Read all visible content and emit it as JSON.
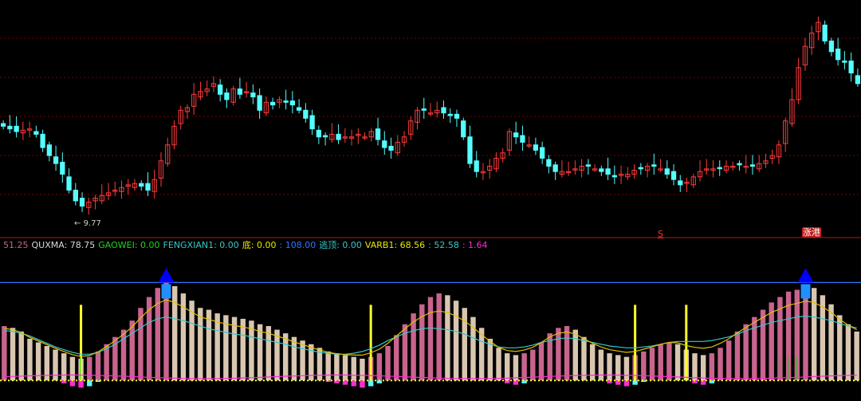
{
  "colors": {
    "background": "#000000",
    "up_candle": "#ff3b3b",
    "down_candle": "#54ffff",
    "grid": "#7a0000",
    "divider": "#b01818",
    "ceiling_line": "#2e74ff",
    "pink_bars": "#c9648e",
    "tan_bars": "#d9c6b0",
    "yellow": "#ffff2a",
    "magenta": "#ff2bd4",
    "cyan_line": "#38c8c8",
    "gold_line": "#e0c000",
    "green_ticks": "#11c811"
  },
  "price_panel": {
    "low_label": "9.77",
    "signal_s": "S",
    "signal_zg": "涨港"
  },
  "indicator_legend": [
    {
      "text": "51.25",
      "color": "#c9648e"
    },
    {
      "text": "QUXMA: 78.75",
      "color": "#d8d8d8"
    },
    {
      "text": "GAOWEI: 0.00",
      "color": "#22d022"
    },
    {
      "text": "FENGXIAN1: 0.00",
      "color": "#38c8c8"
    },
    {
      "text": "底: 0.00",
      "color": "#e8e800"
    },
    {
      "text": ": 108.00",
      "color": "#2e74ff"
    },
    {
      "text": "逃顶: 0.00",
      "color": "#38c8c8"
    },
    {
      "text": "VARB1: 68.56",
      "color": "#e8e800"
    },
    {
      "text": ": 52.58",
      "color": "#38c8c8"
    },
    {
      "text": ": 1.64",
      "color": "#ff2bd4"
    }
  ],
  "chart_data": [
    {
      "type": "candlestick",
      "title": "",
      "ylim": [
        9.0,
        17.5
      ],
      "min_label": 9.77,
      "candles_close": [
        13.0,
        12.9,
        12.8,
        12.85,
        12.9,
        12.7,
        12.2,
        11.9,
        11.6,
        11.2,
        10.6,
        10.2,
        10.0,
        10.15,
        10.3,
        10.4,
        10.5,
        10.6,
        10.7,
        10.8,
        10.85,
        10.75,
        10.6,
        11.0,
        11.7,
        12.3,
        13.0,
        13.6,
        13.7,
        14.2,
        14.3,
        14.4,
        14.6,
        14.2,
        14.0,
        14.4,
        14.2,
        14.3,
        14.1,
        13.6,
        13.9,
        13.8,
        14.0,
        13.9,
        13.8,
        13.6,
        13.3,
        12.9,
        12.6,
        12.6,
        12.7,
        12.5,
        12.6,
        12.6,
        12.7,
        12.6,
        12.8,
        12.5,
        12.2,
        12.1,
        12.4,
        12.6,
        13.2,
        13.6,
        13.6,
        13.5,
        13.6,
        13.5,
        13.4,
        13.3,
        12.6,
        11.6,
        11.3,
        11.3,
        11.5,
        11.8,
        12.0,
        12.8,
        12.6,
        12.4,
        12.3,
        12.1,
        11.8,
        11.5,
        11.3,
        11.3,
        11.3,
        11.4,
        11.5,
        11.5,
        11.4,
        11.3,
        11.2,
        11.1,
        11.2,
        11.2,
        11.35,
        11.4,
        11.5,
        11.5,
        11.4,
        11.2,
        11.0,
        10.8,
        10.9,
        11.1,
        11.3,
        11.4,
        11.4,
        11.45,
        11.5,
        11.5,
        11.55,
        11.5,
        11.5,
        11.6,
        11.7,
        11.9,
        12.3,
        13.2,
        14.0,
        15.2,
        16.0,
        16.5,
        16.9,
        16.2,
        15.8,
        15.5,
        15.4,
        15.0,
        14.6
      ]
    },
    {
      "type": "indicator",
      "title": "",
      "ylim": [
        -20,
        140
      ],
      "ceiling": 108,
      "series": [
        {
          "name": "QUXMA",
          "values": [
            60,
            58,
            54,
            46,
            42,
            38,
            34,
            30,
            26,
            24,
            26,
            32,
            40,
            48,
            56,
            66,
            80,
            92,
            102,
            108,
            104,
            96,
            88,
            80,
            78,
            74,
            72,
            70,
            68,
            66,
            62,
            60,
            56,
            52,
            48,
            44,
            40,
            36,
            32,
            30,
            28,
            26,
            24,
            26,
            30,
            38,
            50,
            62,
            74,
            84,
            92,
            96,
            94,
            88,
            80,
            70,
            58,
            46,
            36,
            30,
            28,
            30,
            34,
            42,
            52,
            58,
            60,
            56,
            48,
            40,
            34,
            30,
            28,
            26,
            28,
            32,
            36,
            40,
            42,
            40,
            34,
            30,
            28,
            30,
            36,
            44,
            54,
            62,
            70,
            78,
            86,
            92,
            98,
            100,
            104,
            102,
            94,
            84,
            72,
            62,
            54
          ]
        },
        {
          "name": "VARB1",
          "values": [
            55,
            54,
            52,
            49,
            45,
            41,
            37,
            34,
            31,
            29,
            29,
            31,
            35,
            40,
            46,
            52,
            58,
            64,
            68,
            70,
            68,
            66,
            63,
            60,
            57,
            55,
            53,
            51,
            50,
            48,
            46,
            44,
            42,
            40,
            37,
            35,
            33,
            31,
            30,
            29,
            29,
            30,
            32,
            35,
            39,
            44,
            48,
            52,
            55,
            57,
            58,
            57,
            56,
            54,
            51,
            47,
            43,
            40,
            37,
            36,
            36,
            37,
            39,
            42,
            44,
            46,
            47,
            46,
            44,
            42,
            40,
            38,
            37,
            36,
            36,
            37,
            38,
            40,
            42,
            43,
            43,
            43,
            43,
            44,
            46,
            48,
            51,
            55,
            58,
            61,
            64,
            66,
            68,
            70,
            71,
            70,
            68,
            66,
            63,
            60,
            58
          ]
        },
        {
          "name": "底",
          "values": [
            0,
            0,
            0,
            0,
            0,
            0,
            0,
            0,
            0,
            108,
            0,
            0,
            0,
            0,
            0,
            0,
            0,
            0,
            0,
            0,
            0,
            0,
            0,
            0,
            0,
            0,
            0,
            0,
            0,
            0,
            0,
            0,
            0,
            0,
            0,
            0,
            0,
            0,
            0,
            0,
            0,
            0,
            0,
            108,
            0,
            0,
            0,
            0,
            0,
            0,
            0,
            0,
            0,
            0,
            0,
            0,
            0,
            0,
            0,
            0,
            0,
            0,
            0,
            0,
            0,
            0,
            0,
            0,
            0,
            0,
            0,
            0,
            0,
            0,
            108,
            0,
            0,
            0,
            0,
            0,
            108,
            0,
            0,
            0,
            0,
            0,
            0,
            0,
            0,
            0,
            0,
            0,
            0,
            0,
            0,
            0,
            0,
            0,
            0,
            0,
            0
          ]
        }
      ]
    }
  ]
}
